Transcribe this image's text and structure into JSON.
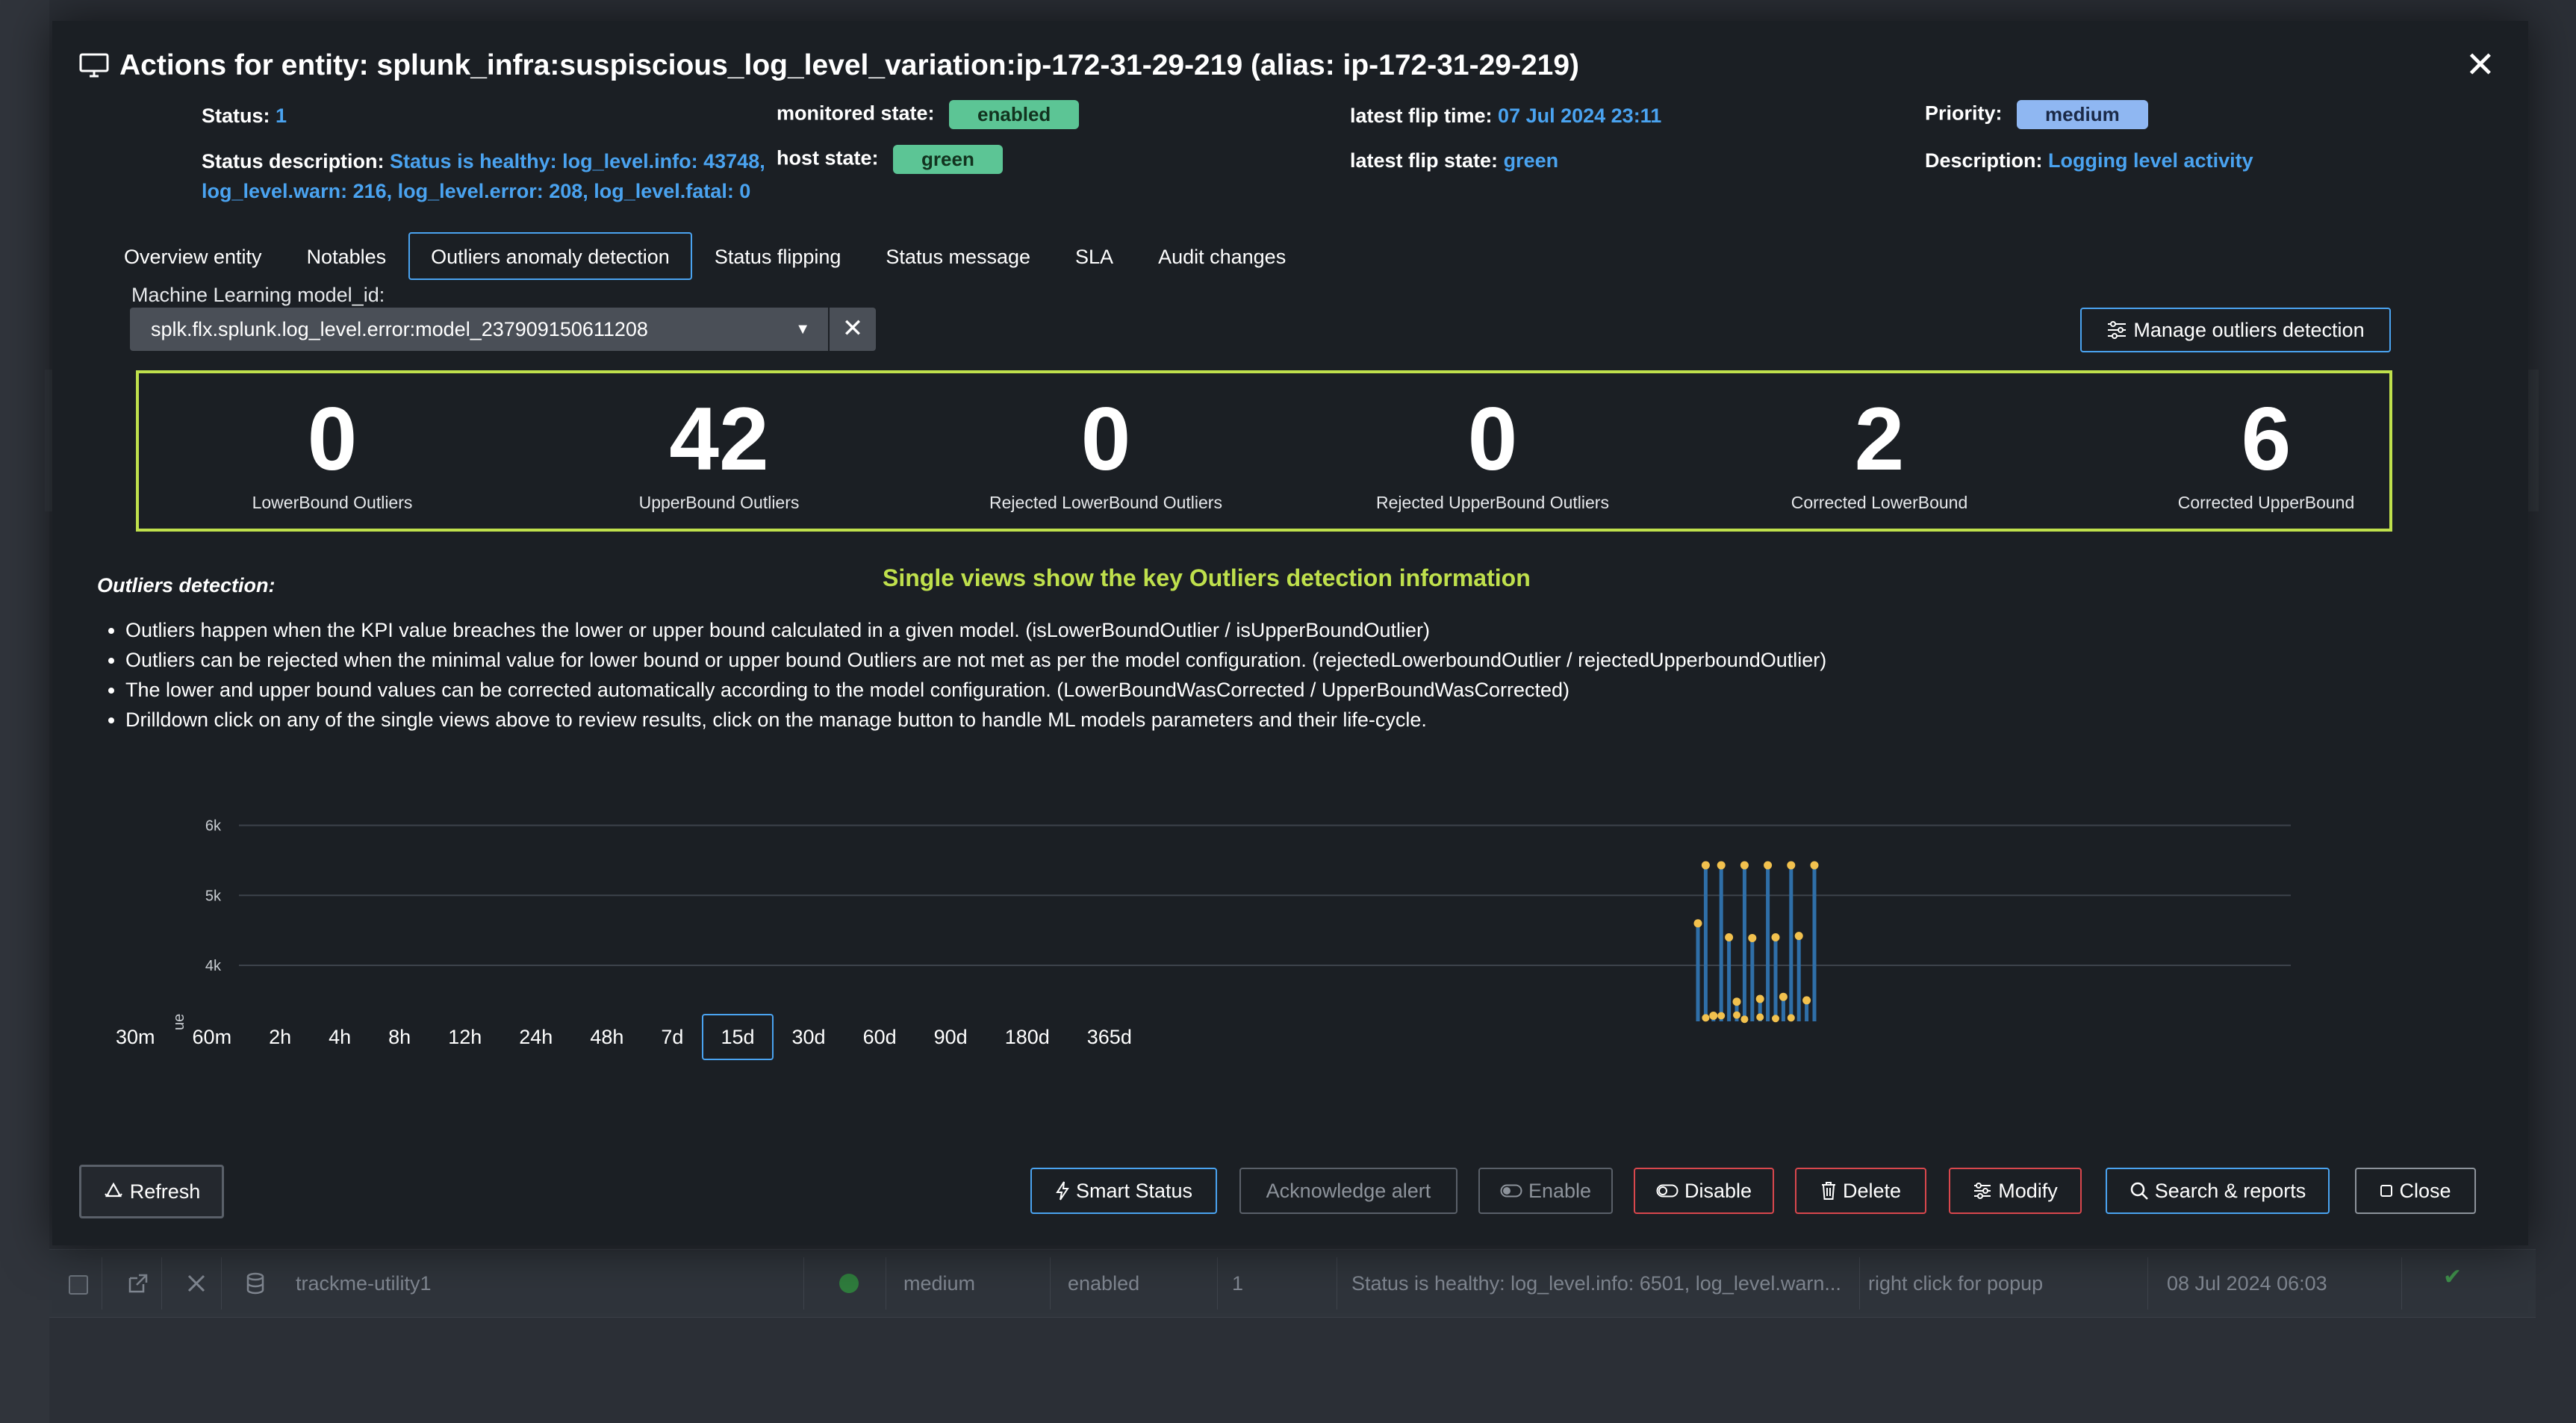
{
  "modal": {
    "title": "Actions for entity: splunk_infra:suspiscious_log_level_variation:ip-172-31-29-219 (alias: ip-172-31-29-219)",
    "close_glyph": "✕"
  },
  "meta": {
    "status_label": "Status:",
    "status_value": "1",
    "status_desc_label": "Status description:",
    "status_desc_value": "Status is healthy: log_level.info: 43748, log_level.warn: 216, log_level.error: 208, log_level.fatal: 0",
    "monitored_label": "monitored state:",
    "monitored_value": "enabled",
    "host_label": "host state:",
    "host_value": "green",
    "flip_time_label": "latest flip time:",
    "flip_time_value": "07 Jul 2024 23:11",
    "flip_state_label": "latest flip state:",
    "flip_state_value": "green",
    "priority_label": "Priority:",
    "priority_value": "medium",
    "description_label": "Description:",
    "description_value": "Logging level activity"
  },
  "tabs": [
    {
      "label": "Overview entity",
      "active": false
    },
    {
      "label": "Notables",
      "active": false
    },
    {
      "label": "Outliers anomaly detection",
      "active": true
    },
    {
      "label": "Status flipping",
      "active": false
    },
    {
      "label": "Status message",
      "active": false
    },
    {
      "label": "SLA",
      "active": false
    },
    {
      "label": "Audit changes",
      "active": false
    }
  ],
  "ml": {
    "label": "Machine Learning model_id:",
    "selected": "splk.flx.splunk.log_level.error:model_237909150611208",
    "caret": "▼",
    "clear": "✕"
  },
  "manage_button": "Manage outliers detection",
  "single_views": [
    {
      "value": "0",
      "label": "LowerBound Outliers"
    },
    {
      "value": "42",
      "label": "UpperBound Outliers"
    },
    {
      "value": "0",
      "label": "Rejected LowerBound Outliers"
    },
    {
      "value": "0",
      "label": "Rejected UpperBound Outliers"
    },
    {
      "value": "2",
      "label": "Corrected LowerBound"
    },
    {
      "value": "6",
      "label": "Corrected UpperBound"
    }
  ],
  "outliers": {
    "title": "Outliers detection:",
    "headline": "Single views show the key Outliers detection information",
    "bullets": [
      "Outliers happen when the KPI value breaches the lower or upper bound calculated in a given model. (isLowerBoundOutlier / isUpperBoundOutlier)",
      "Outliers can be rejected when the minimal value for lower bound or upper bound Outliers are not met as per the model configuration. (rejectedLowerboundOutlier / rejectedUpperboundOutlier)",
      "The lower and upper bound values can be corrected automatically according to the model configuration. (LowerBoundWasCorrected / UpperBoundWasCorrected)",
      "Drilldown click on any of the single views above to review results, click on the manage button to handle ML models parameters and their life-cycle."
    ]
  },
  "chart_data": {
    "type": "bar",
    "ylabel": "ue",
    "y_ticks": [
      "4k",
      "5k",
      "6k"
    ],
    "ylim": [
      3200,
      6400
    ],
    "grid": true,
    "series": [
      {
        "values": [
          3200,
          3250,
          3200,
          3280,
          3200,
          3290,
          3230,
          3200,
          3260,
          3200,
          3240,
          3200,
          3250,
          3200,
          3210,
          3200
        ]
      },
      {
        "values": [
          4600,
          5430,
          3280,
          5430,
          4400,
          3480,
          5430,
          4390,
          3520,
          5430,
          4400,
          3550,
          5430,
          4420,
          3500,
          5430
        ]
      }
    ]
  },
  "time_ranges": [
    {
      "label": "30m",
      "active": false
    },
    {
      "label": "60m",
      "active": false
    },
    {
      "label": "2h",
      "active": false
    },
    {
      "label": "4h",
      "active": false
    },
    {
      "label": "8h",
      "active": false
    },
    {
      "label": "12h",
      "active": false
    },
    {
      "label": "24h",
      "active": false
    },
    {
      "label": "48h",
      "active": false
    },
    {
      "label": "7d",
      "active": false
    },
    {
      "label": "15d",
      "active": true
    },
    {
      "label": "30d",
      "active": false
    },
    {
      "label": "60d",
      "active": false
    },
    {
      "label": "90d",
      "active": false
    },
    {
      "label": "180d",
      "active": false
    },
    {
      "label": "365d",
      "active": false
    }
  ],
  "footer": {
    "refresh": "Refresh",
    "smart_status": "Smart Status",
    "acknowledge": "Acknowledge alert",
    "enable": "Enable",
    "disable": "Disable",
    "delete": "Delete",
    "modify": "Modify",
    "search_reports": "Search & reports",
    "close": "Close"
  },
  "background_row": {
    "name": "trackme-utility1",
    "priority": "medium",
    "state": "enabled",
    "status": "1",
    "status_desc": "Status is healthy: log_level.info: 6501, log_level.warn...",
    "hint": "right click for popup",
    "date": "08 Jul 2024 06:03",
    "check": "✔"
  },
  "colors": {
    "accent": "#4aa3f0",
    "highlight": "#bfe04c",
    "danger": "#d9474d",
    "bar": "#2f6fa8",
    "point": "#f2c14e"
  }
}
